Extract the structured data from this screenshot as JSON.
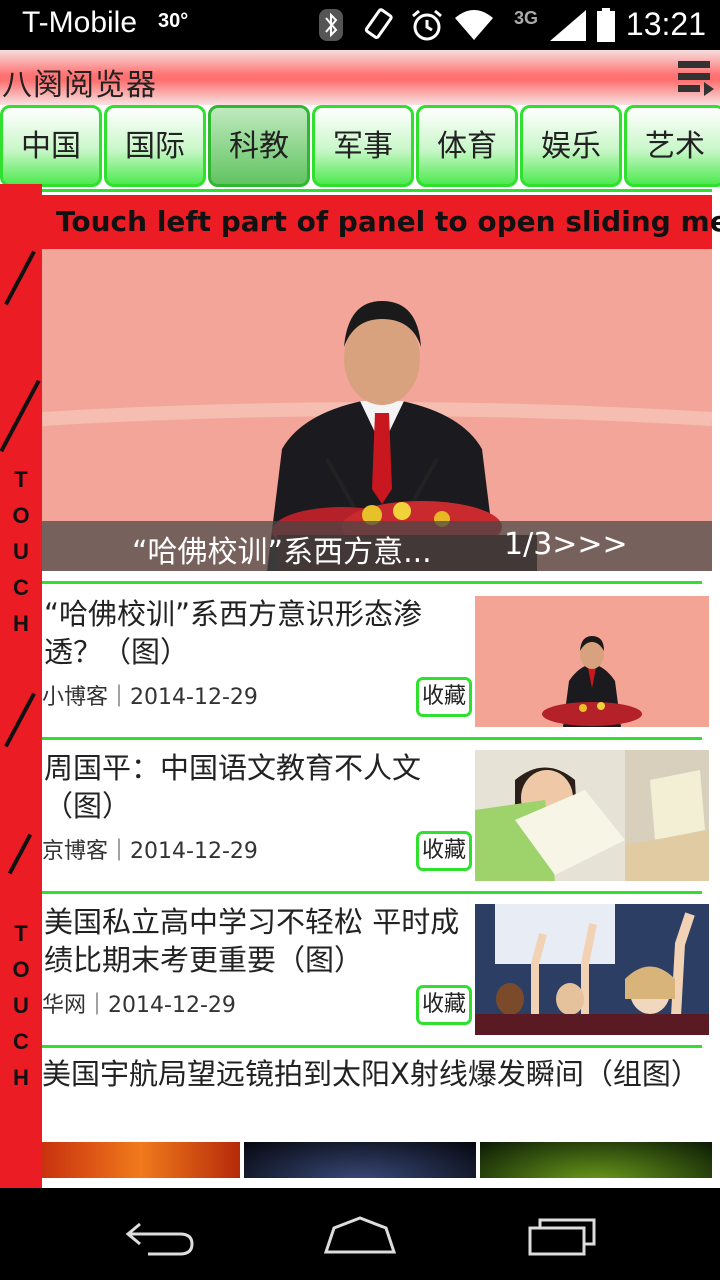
{
  "status_bar": {
    "carrier": "T-Mobile",
    "temperature": "30°",
    "network": "3G",
    "time": "13:21",
    "icons": [
      "bluetooth-icon",
      "rotation-icon",
      "alarm-icon",
      "wifi-icon",
      "signal-icon",
      "battery-icon"
    ]
  },
  "app": {
    "title": "八阕阅览器",
    "menu_icon": "menu-lines-icon"
  },
  "tabs": [
    {
      "label": "中国",
      "active": false
    },
    {
      "label": "国际",
      "active": false
    },
    {
      "label": "科教",
      "active": true
    },
    {
      "label": "军事",
      "active": false
    },
    {
      "label": "体育",
      "active": false
    },
    {
      "label": "娱乐",
      "active": false
    },
    {
      "label": "艺术",
      "active": false
    }
  ],
  "touch_strip": {
    "words": [
      "TOUCH",
      "TOUCH"
    ]
  },
  "hint": "Touch left part of panel to open sliding menu",
  "hero": {
    "caption": "“哈佛校训”系西方意...",
    "counter": "1/3>>>"
  },
  "news": [
    {
      "title": "“哈佛校训”系西方意识形态渗透？（图）",
      "source": "小博客",
      "date": "2014-12-29",
      "fav_label": "收藏",
      "thumb": "podium-speaker-photo"
    },
    {
      "title": "周国平：中国语文教育不人文（图）",
      "source": "京博客",
      "date": "2014-12-29",
      "fav_label": "收藏",
      "thumb": "girl-reading-book-photo"
    },
    {
      "title": "美国私立高中学习不轻松 平时成绩比期末考更重要（图）",
      "source": "华网",
      "date": "2014-12-29",
      "fav_label": "收藏",
      "thumb": "students-raising-hands-photo"
    }
  ],
  "last_news": {
    "title": "美国宇航局望远镜拍到太阳X射线爆发瞬间（组图）"
  },
  "colors": {
    "accent_green": "#2fe02f",
    "touch_red": "#ec1c24",
    "title_red": "#ff7070"
  },
  "nav": [
    "back-icon",
    "home-icon",
    "recents-icon"
  ]
}
